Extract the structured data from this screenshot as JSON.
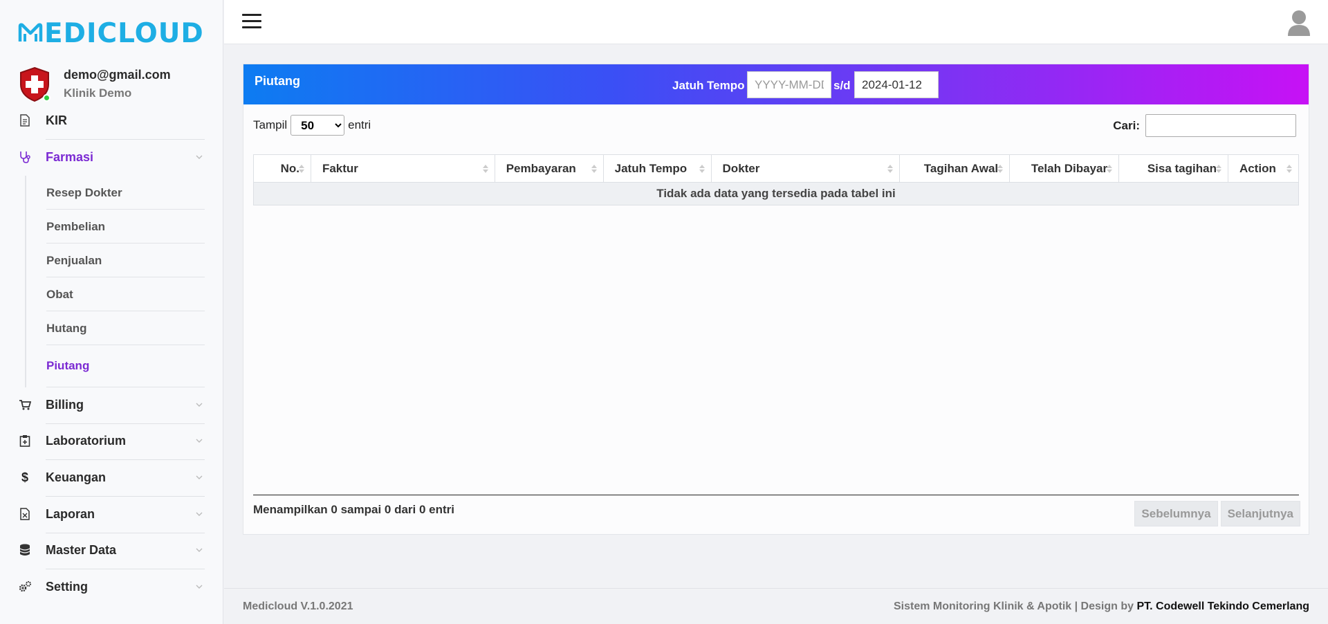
{
  "brand": {
    "logo_text": "EDICLOUD",
    "accent_color": "#1eaee4"
  },
  "user": {
    "email": "demo@gmail.com",
    "clinic": "Klinik Demo",
    "status_color": "#2ecc40"
  },
  "sidebar": {
    "items": [
      {
        "label": "KIR",
        "icon": "document-icon"
      },
      {
        "label": "Farmasi",
        "icon": "stethoscope-icon",
        "active": true,
        "expanded": true
      },
      {
        "label": "Billing",
        "icon": "cart-icon"
      },
      {
        "label": "Laboratorium",
        "icon": "clipboard-icon"
      },
      {
        "label": "Keuangan",
        "icon": "dollar-icon"
      },
      {
        "label": "Laporan",
        "icon": "report-file-icon"
      },
      {
        "label": "Master Data",
        "icon": "database-icon"
      },
      {
        "label": "Setting",
        "icon": "gears-icon"
      }
    ],
    "farmasi_sub": [
      {
        "label": "Resep Dokter"
      },
      {
        "label": "Pembelian"
      },
      {
        "label": "Penjualan"
      },
      {
        "label": "Obat"
      },
      {
        "label": "Hutang"
      },
      {
        "label": "Piutang",
        "active": true
      }
    ],
    "active_color": "#7b2ad3"
  },
  "card": {
    "title": "Piutang",
    "filter": {
      "label": "Jatuh Tempo",
      "from_placeholder": "YYYY-MM-DD",
      "from_value": "",
      "separator": "s/d",
      "to_value": "2024-01-12"
    },
    "show": {
      "prefix": "Tampil",
      "selected": "50",
      "suffix": "entri"
    },
    "search": {
      "label": "Cari:",
      "value": ""
    },
    "table": {
      "columns": [
        "No.",
        "Faktur",
        "Pembayaran",
        "Jatuh Tempo",
        "Dokter",
        "Tagihan Awal",
        "Telah Dibayar",
        "Sisa tagihan",
        "Action"
      ],
      "empty_message": "Tidak ada data yang tersedia pada tabel ini"
    },
    "info": "Menampilkan 0 sampai 0 dari 0 entri",
    "pager": {
      "prev": "Sebelumnya",
      "next": "Selanjutnya"
    }
  },
  "footer": {
    "version": "Medicloud V.1.0.2021",
    "credit_prefix": "Sistem Monitoring Klinik & Apotik | Design by ",
    "company": "PT. Codewell Tekindo Cemerlang"
  }
}
